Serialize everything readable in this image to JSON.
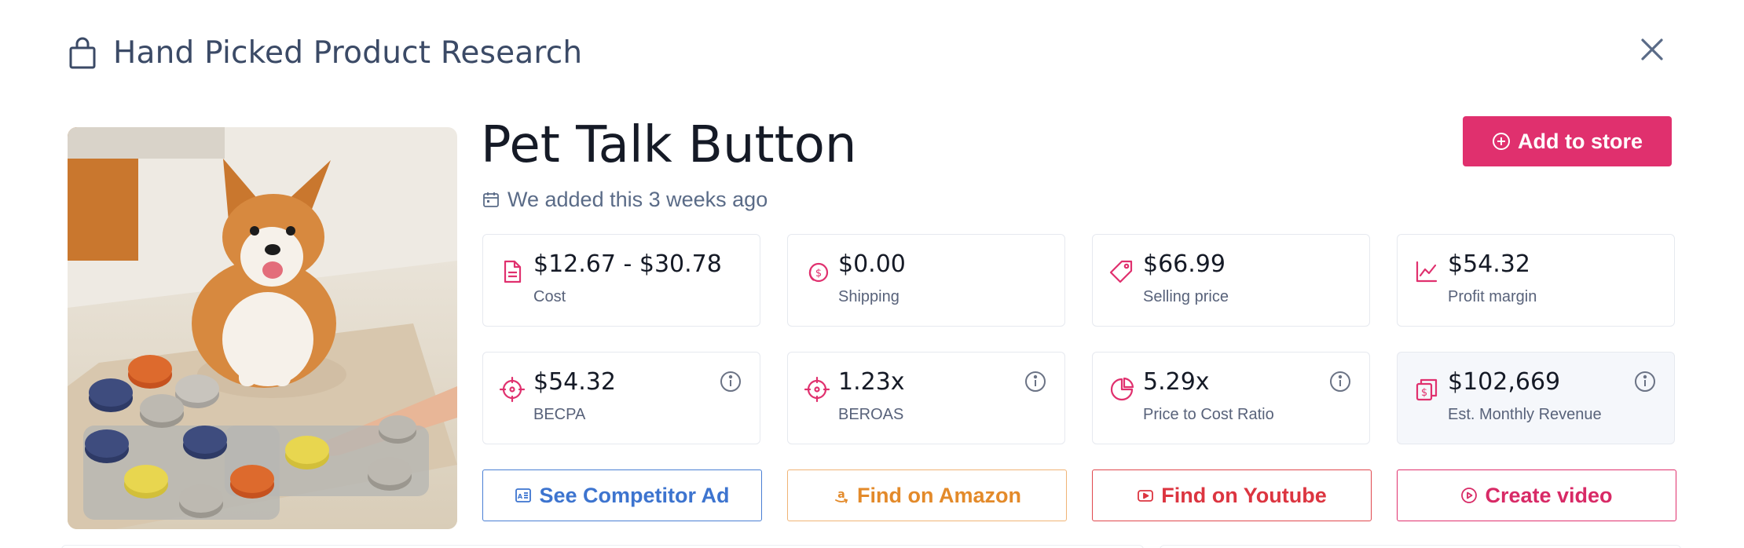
{
  "header": {
    "title": "Hand Picked Product Research",
    "icon": "shopping-bag-icon"
  },
  "close": {
    "icon": "close-icon"
  },
  "product": {
    "title": "Pet Talk Button",
    "added_text": "We added this 3 weeks ago",
    "image_description_icon": "product-photo",
    "add_button_label": "Add to store"
  },
  "metrics": [
    {
      "value": "$12.67 - $30.78",
      "label": "Cost",
      "icon": "document-icon"
    },
    {
      "value": "$0.00",
      "label": "Shipping",
      "icon": "coins-icon"
    },
    {
      "value": "$66.99",
      "label": "Selling price",
      "icon": "tag-icon"
    },
    {
      "value": "$54.32",
      "label": "Profit margin",
      "icon": "chart-line-icon"
    },
    {
      "value": "$54.32",
      "label": "BECPA",
      "icon": "crosshair-icon"
    },
    {
      "value": "1.23x",
      "label": "BEROAS",
      "icon": "crosshair-icon"
    },
    {
      "value": "5.29x",
      "label": "Price to Cost Ratio",
      "icon": "pie-chart-icon"
    },
    {
      "value": "$102,669",
      "label": "Est. Monthly Revenue",
      "icon": "revenue-icon"
    }
  ],
  "actions": [
    {
      "label": "See Competitor Ad",
      "icon": "ad-icon",
      "color": "#3d74cf"
    },
    {
      "label": "Find on Amazon",
      "icon": "amazon-icon",
      "color": "#e38a2a"
    },
    {
      "label": "Find on Youtube",
      "icon": "youtube-icon",
      "color": "#dc3540"
    },
    {
      "label": "Create video",
      "icon": "play-circle-icon",
      "color": "#d82a66"
    }
  ],
  "colors": {
    "accent": "#e0306e",
    "heading": "#3b4a66",
    "muted": "#58627a"
  }
}
